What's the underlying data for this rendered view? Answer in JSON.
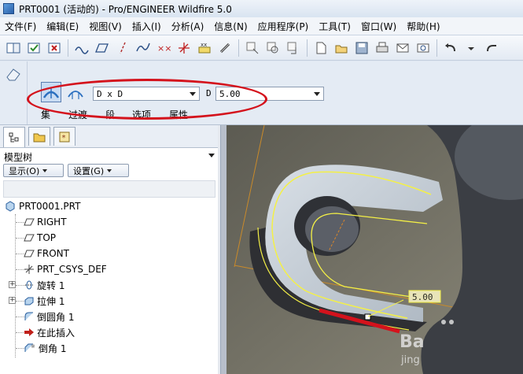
{
  "window": {
    "title": "PRT0001 (活动的) - Pro/ENGINEER Wildfire 5.0"
  },
  "menu": [
    "文件(F)",
    "编辑(E)",
    "视图(V)",
    "插入(I)",
    "分析(A)",
    "信息(N)",
    "应用程序(P)",
    "工具(T)",
    "窗口(W)",
    "帮助(H)"
  ],
  "dashboard": {
    "mode_combo": "D x D",
    "d_label": "D",
    "d_value": "5.00",
    "tabs": [
      "集",
      "过渡",
      "段",
      "选项",
      "属性"
    ]
  },
  "panel": {
    "title": "模型树",
    "show_button": "显示(O)",
    "settings_button": "设置(G)",
    "tree": [
      {
        "label": "PRT0001.PRT",
        "icon": "part-icon"
      },
      {
        "label": "RIGHT",
        "icon": "datum-plane-icon"
      },
      {
        "label": "TOP",
        "icon": "datum-plane-icon"
      },
      {
        "label": "FRONT",
        "icon": "datum-plane-icon"
      },
      {
        "label": "PRT_CSYS_DEF",
        "icon": "csys-icon"
      },
      {
        "label": "旋转 1",
        "icon": "revolve-icon"
      },
      {
        "label": "拉伸 1",
        "icon": "extrude-icon"
      },
      {
        "label": "倒圆角 1",
        "icon": "round-icon"
      },
      {
        "label": "在此插入",
        "icon": "insert-here-arrow-icon"
      },
      {
        "label": "倒角 1",
        "icon": "chamfer-icon"
      }
    ]
  },
  "viewport": {
    "dim_label": "5.00",
    "watermark": "Ba",
    "watermark_sub": "jing"
  },
  "colors": {
    "highlight_red": "#d4121c",
    "edge_yellow": "#f4f046",
    "part_light": "#c7d0d8",
    "part_dark": "#3b3e44"
  }
}
